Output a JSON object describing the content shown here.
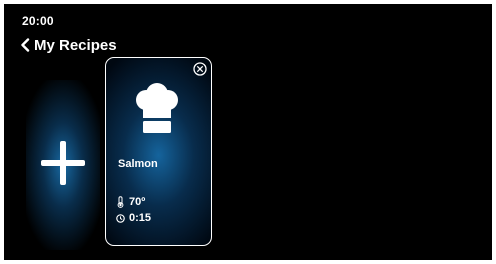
{
  "status_bar": {
    "time": "20:00"
  },
  "header": {
    "back_label": "My Recipes"
  },
  "add_card": {
    "icon": "plus-icon"
  },
  "recipes": [
    {
      "name": "Salmon",
      "temperature": "70º",
      "duration": "0:15",
      "icon": "chef-hat-icon"
    }
  ],
  "colors": {
    "background": "#000000",
    "card_glow": "#1a6aa8",
    "text": "#ffffff"
  }
}
